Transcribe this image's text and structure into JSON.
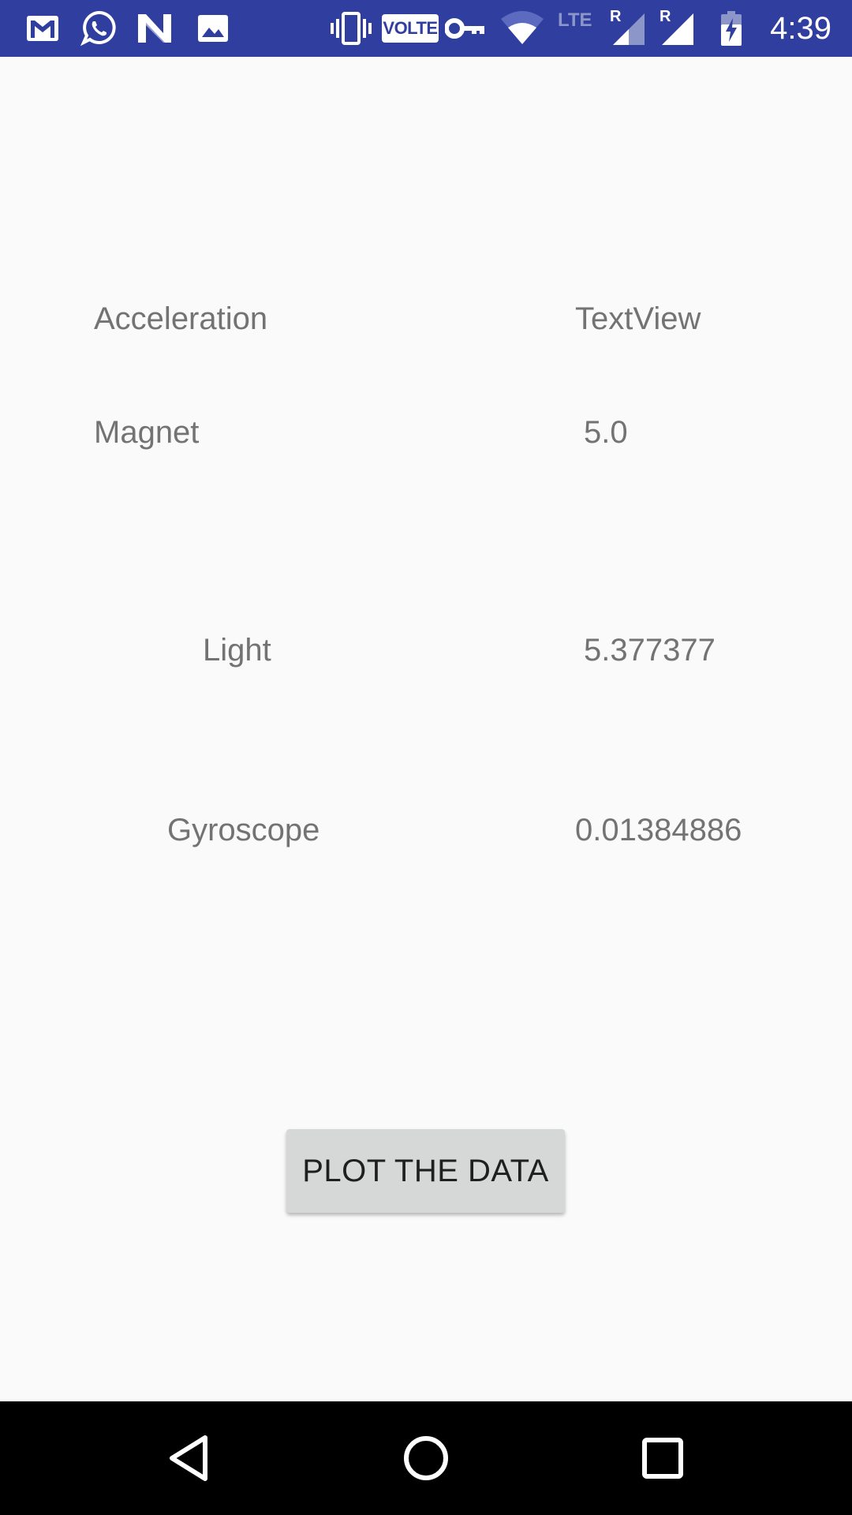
{
  "status_bar": {
    "time": "4:39",
    "volte": "VOLTE",
    "lte": "LTE",
    "roaming_mark": "R",
    "icons": [
      "gmail-icon",
      "whatsapp-icon",
      "n-app-icon",
      "gallery-icon",
      "vibrate-icon",
      "vpn-key-icon",
      "wifi-icon",
      "signal-icon",
      "battery-charging-icon"
    ],
    "background_color": "#303f9f"
  },
  "sensors": {
    "acceleration": {
      "label": "Acceleration",
      "value": "TextView"
    },
    "magnet": {
      "label": "Magnet",
      "value": "5.0"
    },
    "light": {
      "label": "Light",
      "value": "5.377377"
    },
    "gyroscope": {
      "label": "Gyroscope",
      "value": "0.01384886"
    }
  },
  "plot_button": {
    "label": "PLOT THE DATA"
  },
  "nav_bar": {
    "icons": [
      "back-icon",
      "home-icon",
      "recents-icon"
    ]
  }
}
